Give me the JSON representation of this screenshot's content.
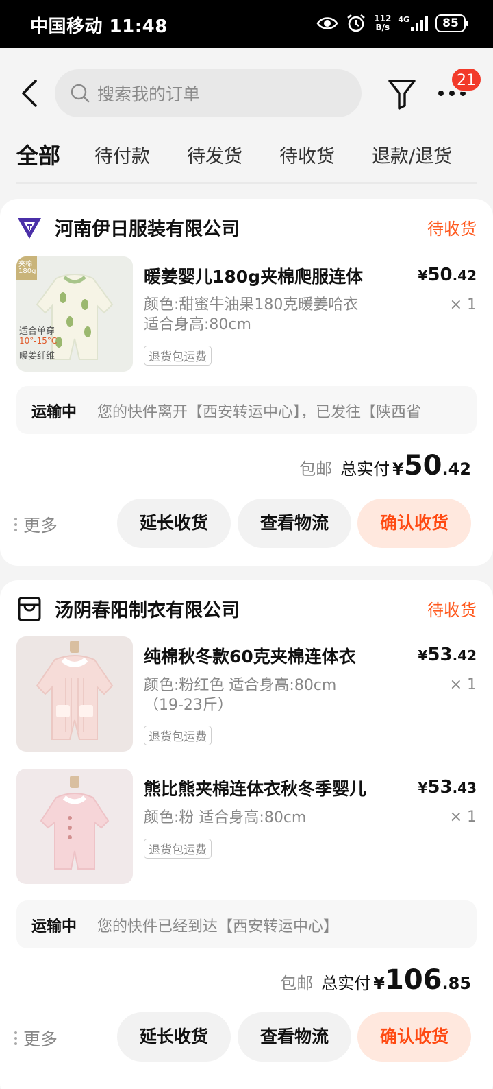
{
  "status_bar": {
    "carrier_time": "中国移动 11:48",
    "net_speed_top": "112",
    "net_speed_bottom": "B/s",
    "net_type": "4G",
    "battery": "85"
  },
  "search": {
    "placeholder": "搜索我的订单"
  },
  "header": {
    "more_badge": "21"
  },
  "tabs": [
    {
      "label": "全部",
      "active": true
    },
    {
      "label": "待付款"
    },
    {
      "label": "待发货"
    },
    {
      "label": "待收货"
    },
    {
      "label": "退款/退货"
    }
  ],
  "orders": [
    {
      "shop_name": "河南伊日服装有限公司",
      "status": "待收货",
      "items": [
        {
          "title": "暖姜婴儿180g夹棉爬服连体",
          "spec_line1": "颜色:甜蜜牛油果180克暖姜哈衣",
          "spec_line2": "适合身高:80cm",
          "return_tag": "退货包运费",
          "price_yen": "¥",
          "price_int": "50",
          "price_dec": ".42",
          "qty": "× 1",
          "thumb_text_top": "夹棉",
          "thumb_text_top2": "180g",
          "thumb_text_1": "适合单穿",
          "thumb_text_2": "10°-15°C",
          "thumb_text_3": "暖姜纤维"
        }
      ],
      "logistics_status": "运输中",
      "logistics_text": "您的快件离开【西安转运中心】，已发往【陕西省",
      "free_shipping": "包邮",
      "total_label": "总实付",
      "total_yen": "¥",
      "total_int": "50",
      "total_dec": ".42",
      "more": "更多",
      "btn_extend": "延长收货",
      "btn_logistics": "查看物流",
      "btn_confirm": "确认收货"
    },
    {
      "shop_name": "汤阴春阳制衣有限公司",
      "status": "待收货",
      "items": [
        {
          "title": "纯棉秋冬款60克夹棉连体衣",
          "spec_line1": "颜色:粉红色 适合身高:80cm",
          "spec_line2": "（19-23斤）",
          "return_tag": "退货包运费",
          "price_yen": "¥",
          "price_int": "53",
          "price_dec": ".42",
          "qty": "× 1"
        },
        {
          "title": "熊比熊夹棉连体衣秋冬季婴儿",
          "spec_line1": "颜色:粉 适合身高:80cm",
          "return_tag": "退货包运费",
          "price_yen": "¥",
          "price_int": "53",
          "price_dec": ".43",
          "qty": "× 1"
        }
      ],
      "logistics_status": "运输中",
      "logistics_text": "您的快件已经到达【西安转运中心】",
      "free_shipping": "包邮",
      "total_label": "总实付",
      "total_yen": "¥",
      "total_int": "106",
      "total_dec": ".85",
      "more": "更多",
      "btn_extend": "延长收货",
      "btn_logistics": "查看物流",
      "btn_confirm": "确认收货"
    }
  ],
  "colors": {
    "accent": "#ff5a1f",
    "confirm_bg": "#ffe8de",
    "badge": "#f23a2a"
  }
}
